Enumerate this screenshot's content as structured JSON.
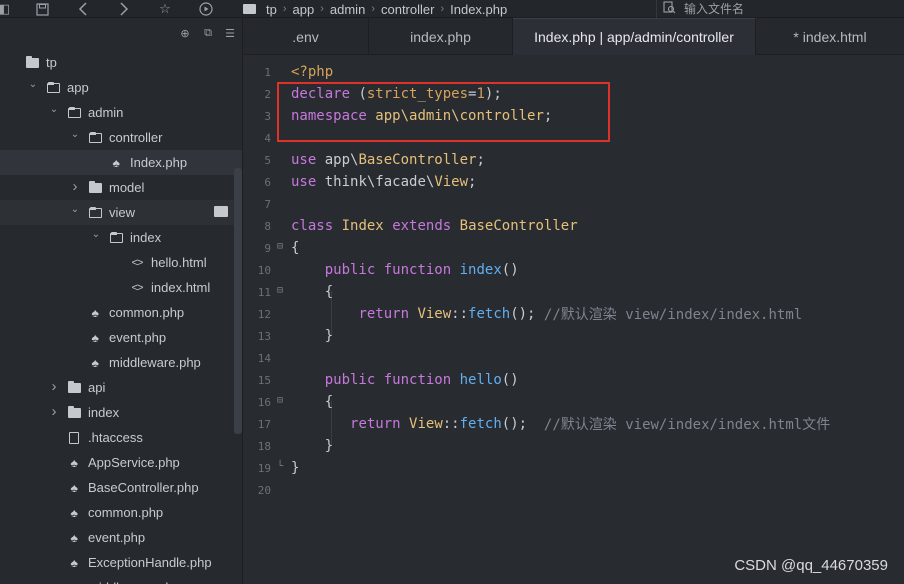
{
  "topbar": {
    "icons": [
      "panel-icon",
      "save-icon",
      "back-icon",
      "forward-icon",
      "star-icon",
      "run-icon"
    ],
    "breadcrumb": [
      "tp",
      "app",
      "admin",
      "controller",
      "Index.php"
    ],
    "file_search_placeholder": "输入文件名"
  },
  "sidebar": {
    "tree": [
      {
        "label": "tp",
        "indent": 0,
        "arrow": "",
        "icon": "folder",
        "name": "tp"
      },
      {
        "label": "app",
        "indent": 1,
        "arrow": "down",
        "icon": "folder-open",
        "name": "app"
      },
      {
        "label": "admin",
        "indent": 2,
        "arrow": "down",
        "icon": "folder-open",
        "name": "admin"
      },
      {
        "label": "controller",
        "indent": 3,
        "arrow": "down",
        "icon": "folder-open",
        "name": "controller"
      },
      {
        "label": "Index.php",
        "indent": 4,
        "arrow": "",
        "icon": "php",
        "name": "index-php",
        "selected": true
      },
      {
        "label": "model",
        "indent": 3,
        "arrow": "right",
        "icon": "folder",
        "name": "model"
      },
      {
        "label": "view",
        "indent": 3,
        "arrow": "down",
        "icon": "folder-open",
        "name": "view",
        "hover": true
      },
      {
        "label": "index",
        "indent": 4,
        "arrow": "down",
        "icon": "folder-open",
        "name": "view-index"
      },
      {
        "label": "hello.html",
        "indent": 5,
        "arrow": "",
        "icon": "code",
        "name": "hello-html"
      },
      {
        "label": "index.html",
        "indent": 5,
        "arrow": "",
        "icon": "code",
        "name": "index-html"
      },
      {
        "label": "common.php",
        "indent": 3,
        "arrow": "",
        "icon": "php",
        "name": "admin-common-php"
      },
      {
        "label": "event.php",
        "indent": 3,
        "arrow": "",
        "icon": "php",
        "name": "admin-event-php"
      },
      {
        "label": "middleware.php",
        "indent": 3,
        "arrow": "",
        "icon": "php",
        "name": "admin-middleware-php"
      },
      {
        "label": "api",
        "indent": 2,
        "arrow": "right",
        "icon": "folder",
        "name": "api"
      },
      {
        "label": "index",
        "indent": 2,
        "arrow": "right",
        "icon": "folder",
        "name": "app-index"
      },
      {
        "label": ".htaccess",
        "indent": 2,
        "arrow": "",
        "icon": "file",
        "name": "htaccess"
      },
      {
        "label": "AppService.php",
        "indent": 2,
        "arrow": "",
        "icon": "php",
        "name": "appservice-php"
      },
      {
        "label": "BaseController.php",
        "indent": 2,
        "arrow": "",
        "icon": "php",
        "name": "basecontroller-php"
      },
      {
        "label": "common.php",
        "indent": 2,
        "arrow": "",
        "icon": "php",
        "name": "common-php"
      },
      {
        "label": "event.php",
        "indent": 2,
        "arrow": "",
        "icon": "php",
        "name": "event-php"
      },
      {
        "label": "ExceptionHandle.php",
        "indent": 2,
        "arrow": "",
        "icon": "php",
        "name": "exceptionhandle-php"
      },
      {
        "label": "middleware.php",
        "indent": 2,
        "arrow": "",
        "icon": "php",
        "name": "middleware-php"
      }
    ]
  },
  "tabs": [
    {
      "label": ".env",
      "active": false
    },
    {
      "label": "index.php",
      "active": false
    },
    {
      "label": "Index.php | app/admin/controller",
      "active": true
    },
    {
      "label": "* index.html",
      "active": false
    }
  ],
  "code_lines": [
    [
      [
        "str",
        "<?php"
      ]
    ],
    [
      [
        "kw",
        "declare"
      ],
      [
        "pl",
        " ("
      ],
      [
        "str",
        "strict_types"
      ],
      [
        "pl",
        "="
      ],
      [
        "num",
        "1"
      ],
      [
        "pl",
        ");"
      ]
    ],
    [
      [
        "kw",
        "namespace"
      ],
      [
        "pl",
        " "
      ],
      [
        "cls",
        "app\\admin\\controller"
      ],
      [
        "pl",
        ";"
      ]
    ],
    [],
    [
      [
        "kw",
        "use"
      ],
      [
        "pl",
        " app\\"
      ],
      [
        "cls",
        "BaseController"
      ],
      [
        "pl",
        ";"
      ]
    ],
    [
      [
        "kw",
        "use"
      ],
      [
        "pl",
        " think\\facade\\"
      ],
      [
        "cls",
        "View"
      ],
      [
        "pl",
        ";"
      ]
    ],
    [],
    [
      [
        "kw",
        "class"
      ],
      [
        "pl",
        " "
      ],
      [
        "cls",
        "Index"
      ],
      [
        "pl",
        " "
      ],
      [
        "kw",
        "extends"
      ],
      [
        "pl",
        " "
      ],
      [
        "cls",
        "BaseController"
      ]
    ],
    [
      [
        "pl",
        "{"
      ]
    ],
    [
      [
        "pl",
        "    "
      ],
      [
        "kw",
        "public"
      ],
      [
        "pl",
        " "
      ],
      [
        "kw",
        "function"
      ],
      [
        "pl",
        " "
      ],
      [
        "fn",
        "index"
      ],
      [
        "pl",
        "()"
      ]
    ],
    [
      [
        "pl",
        "    {"
      ]
    ],
    [
      [
        "pl",
        "        "
      ],
      [
        "kw",
        "return"
      ],
      [
        "pl",
        " "
      ],
      [
        "cls",
        "View"
      ],
      [
        "pl",
        "::"
      ],
      [
        "fn",
        "fetch"
      ],
      [
        "pl",
        "(); "
      ],
      [
        "cm",
        "//默认渲染 view/index/index.html"
      ]
    ],
    [
      [
        "pl",
        "    }"
      ]
    ],
    [],
    [
      [
        "pl",
        "    "
      ],
      [
        "kw",
        "public"
      ],
      [
        "pl",
        " "
      ],
      [
        "kw",
        "function"
      ],
      [
        "pl",
        " "
      ],
      [
        "fn",
        "hello"
      ],
      [
        "pl",
        "()"
      ]
    ],
    [
      [
        "pl",
        "    {"
      ]
    ],
    [
      [
        "pl",
        "       "
      ],
      [
        "kw",
        "return"
      ],
      [
        "pl",
        " "
      ],
      [
        "cls",
        "View"
      ],
      [
        "pl",
        "::"
      ],
      [
        "fn",
        "fetch"
      ],
      [
        "pl",
        "();  "
      ],
      [
        "cm",
        "//默认渲染 view/index/index.html文件"
      ]
    ],
    [
      [
        "pl",
        "    }"
      ]
    ],
    [
      [
        "pl",
        "}"
      ]
    ],
    []
  ],
  "fold_lines": [
    9,
    11,
    16,
    19
  ],
  "watermark": "CSDN @qq_44670359",
  "colors": {
    "highlight_box": "#e0302a",
    "keyword": "#c678dd",
    "class": "#e5c07b",
    "function": "#61afef",
    "string": "#d8a35a"
  }
}
